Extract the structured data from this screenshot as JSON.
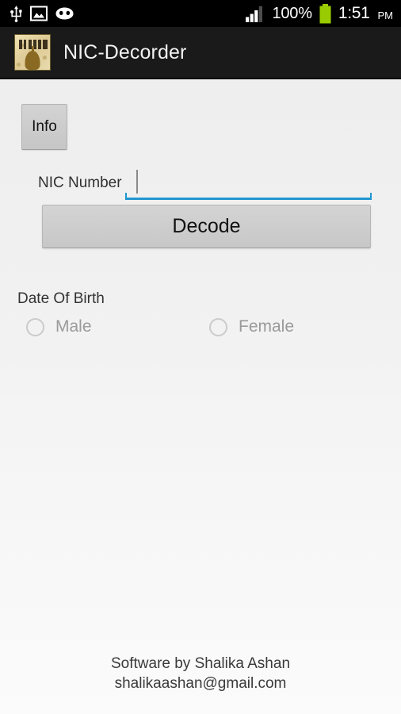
{
  "status_bar": {
    "left_icons": [
      {
        "name": "usb-icon",
        "label": "USB connected"
      },
      {
        "name": "screenshot-image-icon",
        "label": "Screenshot captured"
      },
      {
        "name": "cyanogenmod-icon",
        "label": "CyanogenMod"
      }
    ],
    "signal_icon": "signal-bars-icon",
    "battery_percent": "100%",
    "battery_icon": "battery-full-icon",
    "battery_color": "#99cc00",
    "time": "1:51",
    "ampm": "PM",
    "background_color": "#000000"
  },
  "action_bar": {
    "app_icon_name": "app-launcher-icon",
    "title": "NIC-Decorder",
    "background_color": "#1a1a1a",
    "title_color": "#f2f2f2"
  },
  "form": {
    "info_button_label": "Info",
    "nic_label": "NIC Number",
    "nic_value": "",
    "nic_placeholder": "",
    "nic_underline_color": "#2196cf",
    "decode_button_label": "Decode",
    "dob_label": "Date Of Birth",
    "gender_options": [
      {
        "label": "Male",
        "selected": false
      },
      {
        "label": "Female",
        "selected": false
      }
    ]
  },
  "footer": {
    "line1": "Software by Shalika Ashan",
    "line2": "shalikaashan@gmail.com"
  }
}
